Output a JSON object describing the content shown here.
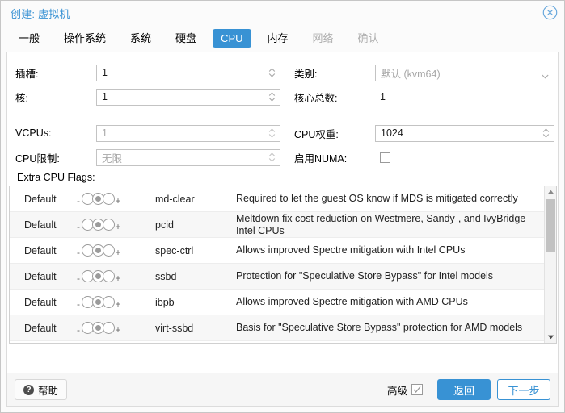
{
  "dialog": {
    "title": "创建: 虚拟机",
    "close_icon": "close-circle-icon"
  },
  "tabs": [
    {
      "label": "一般",
      "state": "normal"
    },
    {
      "label": "操作系统",
      "state": "normal"
    },
    {
      "label": "系统",
      "state": "normal"
    },
    {
      "label": "硬盘",
      "state": "normal"
    },
    {
      "label": "CPU",
      "state": "active"
    },
    {
      "label": "内存",
      "state": "normal"
    },
    {
      "label": "网络",
      "state": "disabled"
    },
    {
      "label": "确认",
      "state": "disabled"
    }
  ],
  "form": {
    "sockets": {
      "label": "插槽:",
      "value": "1",
      "kind": "spinner",
      "muted": false
    },
    "cores": {
      "label": "核:",
      "value": "1",
      "kind": "spinner",
      "muted": false
    },
    "type": {
      "label": "类别:",
      "value": "默认 (kvm64)",
      "kind": "select",
      "muted": true
    },
    "total_cores": {
      "label": "核心总数:",
      "value": "1",
      "kind": "text"
    },
    "vcpus": {
      "label": "VCPUs:",
      "value": "1",
      "kind": "spinner",
      "muted": true
    },
    "cpu_limit": {
      "label": "CPU限制:",
      "value": "无限",
      "kind": "spinner",
      "muted": true
    },
    "cpu_units": {
      "label": "CPU权重:",
      "value": "1024",
      "kind": "spinner",
      "muted": false
    },
    "numa": {
      "label": "启用NUMA:",
      "checked": false
    }
  },
  "flags": {
    "title": "Extra CPU Flags:",
    "state_label": "Default",
    "toggle": {
      "minus": "-",
      "plus": "+",
      "selected_index": 1
    },
    "rows": [
      {
        "state": "Default",
        "name": "md-clear",
        "desc": "Required to let the guest OS know if MDS is mitigated correctly"
      },
      {
        "state": "Default",
        "name": "pcid",
        "desc": "Meltdown fix cost reduction on Westmere, Sandy-, and IvyBridge Intel CPUs"
      },
      {
        "state": "Default",
        "name": "spec-ctrl",
        "desc": "Allows improved Spectre mitigation with Intel CPUs"
      },
      {
        "state": "Default",
        "name": "ssbd",
        "desc": "Protection for \"Speculative Store Bypass\" for Intel models"
      },
      {
        "state": "Default",
        "name": "ibpb",
        "desc": "Allows improved Spectre mitigation with AMD CPUs"
      },
      {
        "state": "Default",
        "name": "virt-ssbd",
        "desc": "Basis for \"Speculative Store Bypass\" protection for AMD models"
      }
    ]
  },
  "footer": {
    "help_label": "帮助",
    "advanced_label": "高级",
    "advanced_checked": true,
    "back_label": "返回",
    "next_label": "下一步"
  },
  "colors": {
    "accent": "#3892d4",
    "title": "#3892d4",
    "disabled_tab": "#b0b0b0",
    "row_alt": "#f7f7f7",
    "toggle": "#9b9b9b"
  }
}
